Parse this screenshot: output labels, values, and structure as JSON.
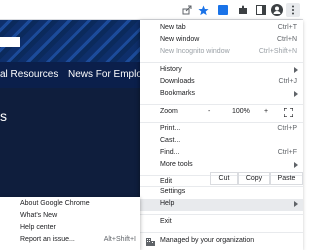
{
  "colors": {
    "menu_bg": "#ffffff",
    "highlight": "#e8eaed",
    "separator": "#e8eaed",
    "shortcut_text": "#5f6368",
    "disabled_text": "#9aa0a6",
    "page_navy": "#0b1f4b",
    "chrome_accent": "#1a73e8"
  },
  "toolbar": {
    "icons": [
      "share-icon",
      "bookmark-star-icon",
      "extension-blue-icon",
      "extension-icon",
      "side-panel-icon",
      "profile-icon",
      "more-vert-icon"
    ]
  },
  "page": {
    "nav_links": [
      "al Resources",
      "News For Employees"
    ],
    "hero_fragment": "s"
  },
  "menu": {
    "new_tab": {
      "label": "New tab",
      "shortcut": "Ctrl+T"
    },
    "new_window": {
      "label": "New window",
      "shortcut": "Ctrl+N"
    },
    "new_incognito": {
      "label": "New Incognito window",
      "shortcut": "Ctrl+Shift+N"
    },
    "history": {
      "label": "History"
    },
    "downloads": {
      "label": "Downloads",
      "shortcut": "Ctrl+J"
    },
    "bookmarks": {
      "label": "Bookmarks"
    },
    "zoom": {
      "label": "Zoom",
      "minus": "-",
      "value": "100%",
      "plus": "+"
    },
    "print": {
      "label": "Print...",
      "shortcut": "Ctrl+P"
    },
    "cast": {
      "label": "Cast..."
    },
    "find": {
      "label": "Find...",
      "shortcut": "Ctrl+F"
    },
    "more_tools": {
      "label": "More tools"
    },
    "edit": {
      "label": "Edit",
      "cut": "Cut",
      "copy": "Copy",
      "paste": "Paste"
    },
    "settings": {
      "label": "Settings"
    },
    "help": {
      "label": "Help"
    },
    "exit": {
      "label": "Exit"
    },
    "managed": {
      "label": "Managed by your organization"
    }
  },
  "help_submenu": {
    "about": {
      "label": "About Google Chrome"
    },
    "whats_new": {
      "label": "What's New"
    },
    "help_center": {
      "label": "Help center"
    },
    "report_issue": {
      "label": "Report an issue...",
      "shortcut": "Alt+Shift+I"
    }
  }
}
